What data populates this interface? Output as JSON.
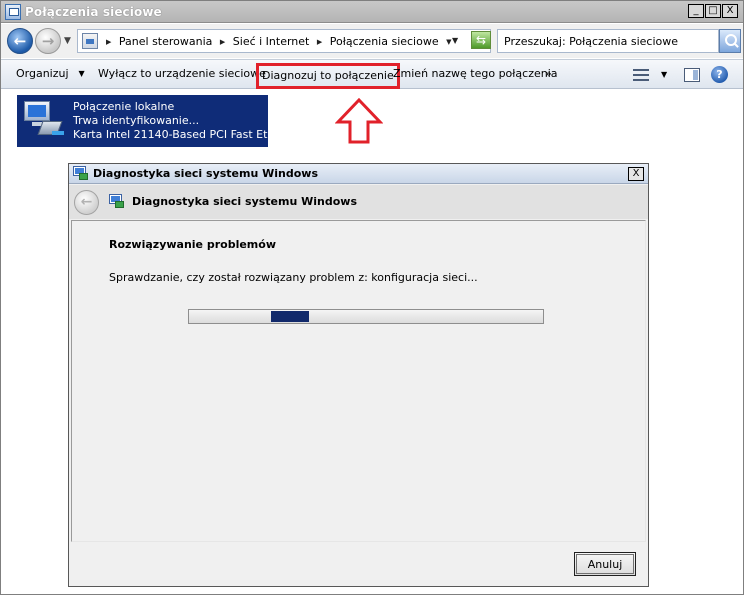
{
  "window": {
    "title": "Połączenia sieciowe",
    "minimize": "_",
    "maximize": "□",
    "close": "X"
  },
  "address": {
    "breadcrumbs": [
      "Panel sterowania",
      "Sieć i Internet",
      "Połączenia sieciowe"
    ],
    "search_value": "Przeszukaj: Połączenia sieciowe"
  },
  "toolbar": {
    "organize": "Organizuj",
    "disable": "Wyłącz to urządzenie sieciowe",
    "diagnose": "Diagnozuj to połączenie",
    "rename": "Zmień nazwę tego połączenia",
    "more": "»",
    "help": "?"
  },
  "connection": {
    "name": "Połączenie lokalne",
    "status": "Trwa identyfikowanie...",
    "adapter": "Karta Intel 21140-Based PCI Fast Et..."
  },
  "dialog": {
    "title": "Diagnostyka sieci systemu Windows",
    "close": "X",
    "header": "Diagnostyka sieci systemu Windows",
    "section": "Rozwiązywanie problemów",
    "status": "Sprawdzanie, czy został rozwiązany problem z: konfiguracja sieci...",
    "progress_mode": "indeterminate",
    "cancel": "Anuluj"
  },
  "colors": {
    "highlight_box": "#e1212a",
    "selection": "#0f2c78",
    "progress_chunk": "#11296b"
  }
}
